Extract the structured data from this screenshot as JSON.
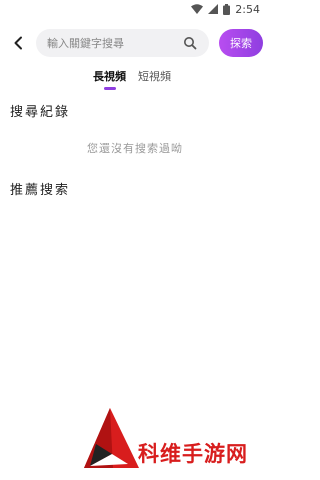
{
  "status_bar": {
    "time": "2:54",
    "icons": [
      "wifi-icon",
      "signal-icon",
      "battery-icon"
    ]
  },
  "search": {
    "placeholder": "輸入關鍵字搜尋",
    "value": "",
    "button_label": "探索",
    "accent_color": "#9b45e6"
  },
  "tabs": [
    {
      "label": "長視頻",
      "active": true
    },
    {
      "label": "短視頻",
      "active": false
    }
  ],
  "history": {
    "title": "搜尋紀錄",
    "empty_text": "您還沒有搜索過呦"
  },
  "recommend": {
    "title": "推薦搜索"
  },
  "watermark": {
    "text": "科维手游网",
    "color": "#d81d1d"
  }
}
